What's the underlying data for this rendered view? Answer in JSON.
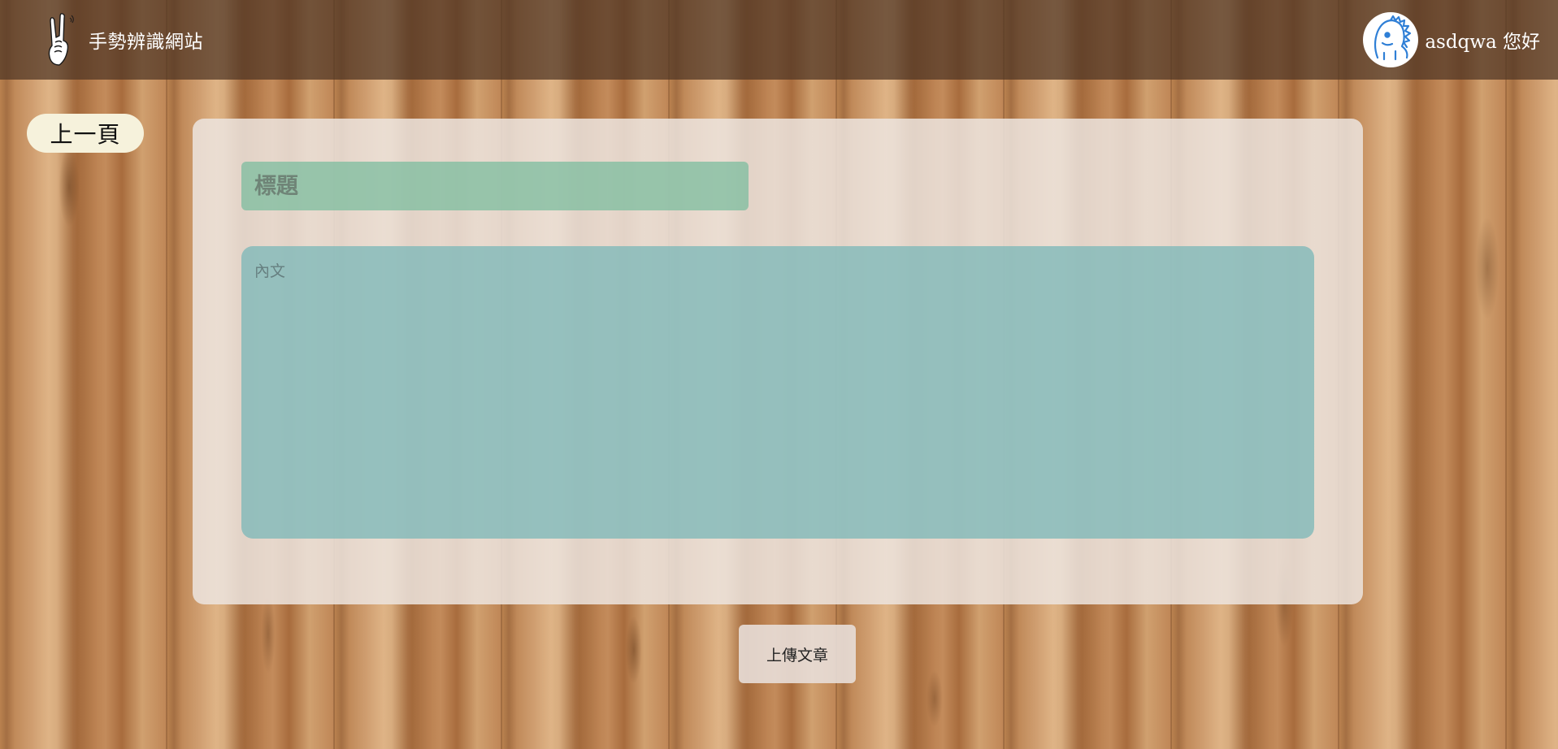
{
  "header": {
    "site_title": "手勢辨識網站",
    "logo_icon": "rock-hand-gesture-icon",
    "user": {
      "avatar_icon": "blue-dinosaur-avatar-icon",
      "greeting": "asdqwa 您好"
    }
  },
  "nav": {
    "back_label": "上一頁"
  },
  "form": {
    "title_placeholder": "標題",
    "title_value": "",
    "body_placeholder": "內文",
    "body_value": "",
    "submit_label": "上傳文章"
  },
  "colors": {
    "header_bg": "#4e3424",
    "back_button_bg": "#f6f2dc",
    "title_field_bg": "#80bea0",
    "body_field_bg": "#82b9b9",
    "panel_bg": "#ece4de",
    "avatar_stroke": "#2f7fd6"
  }
}
